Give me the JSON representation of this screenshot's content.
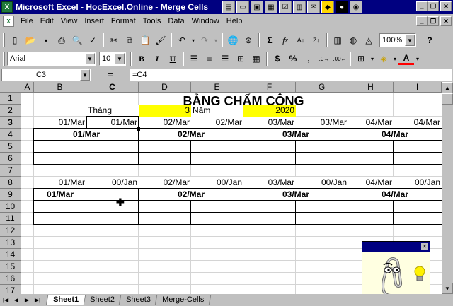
{
  "window": {
    "title": "Microsoft Excel - HocExcel.Online - Merge Cells",
    "app_icon": "excel-icon"
  },
  "menu": {
    "items": [
      "File",
      "Edit",
      "View",
      "Insert",
      "Format",
      "Tools",
      "Data",
      "Window",
      "Help"
    ]
  },
  "toolbar": {
    "zoom": "100%",
    "help": "?"
  },
  "format_toolbar": {
    "font_name": "Arial",
    "font_size": "10",
    "bold": "B",
    "italic": "I",
    "underline": "U",
    "currency": "$",
    "percent": "%",
    "comma": ",",
    "font_color_letter": "A"
  },
  "formula_bar": {
    "name_box": "C3",
    "equals": "=",
    "formula": "=C4"
  },
  "grid": {
    "columns": [
      "A",
      "B",
      "C",
      "D",
      "E",
      "F",
      "G",
      "H",
      "I"
    ],
    "rows": [
      "1",
      "2",
      "3",
      "4",
      "5",
      "6",
      "7",
      "8",
      "9",
      "10",
      "11",
      "12",
      "13",
      "14",
      "15",
      "16",
      "17"
    ],
    "selected_column": "C",
    "selected_row": "3"
  },
  "cells": {
    "title": "BẢNG CHẤM CÔNG",
    "thang_label": "Tháng",
    "month_value": "3",
    "nam_label": "Năm",
    "year_value": "2020",
    "row3": [
      "01/Mar",
      "01/Mar",
      "02/Mar",
      "02/Mar",
      "03/Mar",
      "03/Mar",
      "04/Mar",
      "04/Mar"
    ],
    "row4": [
      "01/Mar",
      "02/Mar",
      "03/Mar",
      "04/Mar"
    ],
    "row8": [
      "01/Mar",
      "00/Jan",
      "02/Mar",
      "00/Jan",
      "03/Mar",
      "00/Jan",
      "04/Mar",
      "00/Jan"
    ],
    "row9": [
      "01/Mar",
      "02/Mar",
      "03/Mar",
      "04/Mar"
    ]
  },
  "sheets": {
    "tabs": [
      "Sheet1",
      "Sheet2",
      "Sheet3",
      "Merge-Cells"
    ],
    "active": "Sheet1"
  },
  "colors": {
    "title_bar": "#000080",
    "highlight": "#ffff00",
    "grid_line": "#d4d4d4"
  }
}
